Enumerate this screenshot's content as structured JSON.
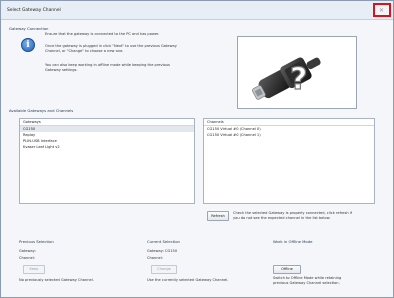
{
  "window": {
    "title": "Select Gateway Channel"
  },
  "gateway_connection": {
    "label": "Gateway Connection",
    "line1": "Ensure that the gateway is connected to the PC and has power.",
    "line2a": "Once the gateway is plugged in click \"Next\" to use the previous Gateway",
    "line2b": "Channel, or \"Change\" to choose a new one.",
    "line3a": "You can also keep working in offline mode while keeping the previous",
    "line3b": "Gateway settings."
  },
  "available": {
    "label": "Available Gateways and Channels",
    "gateways_header": "Gateways",
    "gateways": [
      "CG150",
      "Replay",
      "PLIN-USB Interface",
      "Kvaser Leaf Light v2"
    ],
    "selected_gateway_index": 0,
    "channels_header": "Channels",
    "channels": [
      "CG150 Virtual #0 (Channel 0)",
      "CG150 Virtual #0 (Channel 1)"
    ]
  },
  "refresh": {
    "button": "Refresh",
    "note1": "Check the selected Gateway is properly connected, click refresh if",
    "note2": "you do not see the expected channel in the list below."
  },
  "previous": {
    "label": "Previous Selection",
    "gateway_label": "Gateway:",
    "channel_label": "Channel:",
    "button": "Keep",
    "note": "No previously selected Gateway Channel."
  },
  "current": {
    "label": "Current Selection",
    "gateway_label": "Gateway: CG150",
    "channel_label": "Channel:",
    "button": "Change",
    "note": "Use the currently selected Gateway Channel."
  },
  "offline": {
    "label": "Work in Offline Mode",
    "button": "Offline",
    "note1": "Switch to Offline Mode while retaining",
    "note2": "previous Gateway Channel selection."
  },
  "icons": {
    "close": "close-icon",
    "info": "info-icon",
    "device": "usb-device-question-icon"
  },
  "colors": {
    "close_highlight": "#e0101a",
    "info_blue": "#1d5fb8"
  }
}
